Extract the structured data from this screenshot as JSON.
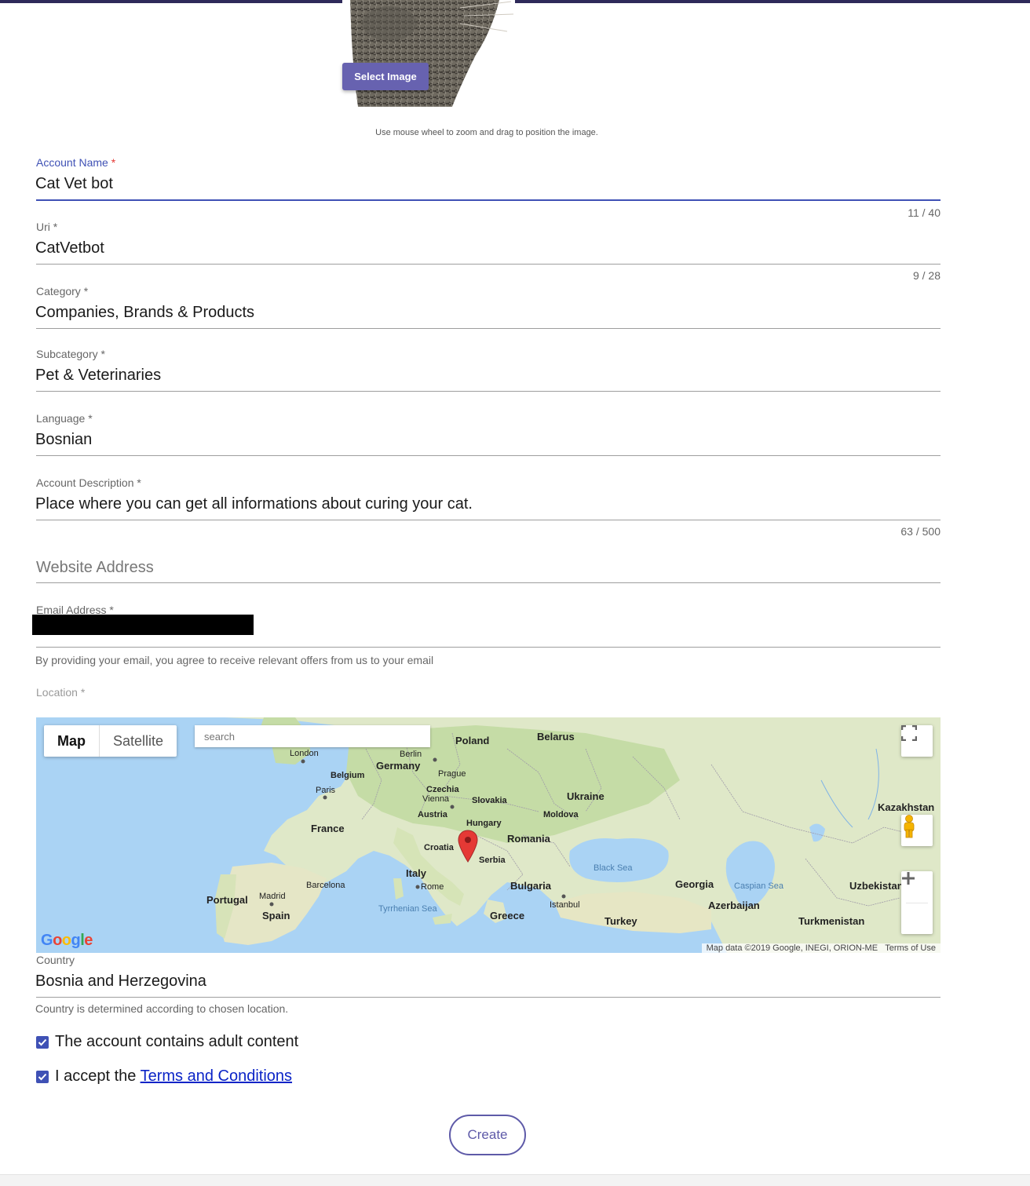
{
  "image_cropper": {
    "select_button": "Select Image",
    "hint": "Use mouse wheel to zoom and drag to position the image."
  },
  "fields": {
    "account_name": {
      "label": "Account Name",
      "required": "*",
      "value": "Cat Vet bot",
      "counter": "11 / 40"
    },
    "uri": {
      "label": "Uri",
      "required": "*",
      "value": "CatVetbot",
      "counter": "9 / 28"
    },
    "category": {
      "label": "Category",
      "required": "*",
      "value": "Companies, Brands & Products"
    },
    "subcategory": {
      "label": "Subcategory",
      "required": "*",
      "value": "Pet & Veterinaries"
    },
    "language": {
      "label": "Language",
      "required": "*",
      "value": "Bosnian"
    },
    "description": {
      "label": "Account Description",
      "required": "*",
      "value": "Place where you can get all informations about curing your cat.",
      "counter": "63 / 500"
    },
    "website": {
      "placeholder": "Website Address"
    },
    "email": {
      "label": "Email Address",
      "required": "*",
      "helper": "By providing your email, you agree to receive relevant offers from us to your email"
    },
    "location": {
      "label": "Location",
      "required": "*"
    },
    "country": {
      "label": "Country",
      "value": "Bosnia and Herzegovina",
      "helper": "Country is determined according to chosen location."
    }
  },
  "map": {
    "type_map": "Map",
    "type_satellite": "Satellite",
    "search_placeholder": "search",
    "attribution": "Map data ©2019 Google, INEGI, ORION-ME",
    "terms": "Terms of Use",
    "logo": "Google",
    "labels": {
      "poland": "Poland",
      "belarus": "Belarus",
      "london": "London",
      "berlin": "Berlin",
      "germany": "Germany",
      "belgium": "Belgium",
      "prague": "Prague",
      "czechia": "Czechia",
      "paris": "Paris",
      "vienna": "Vienna",
      "slovakia": "Slovakia",
      "ukraine": "Ukraine",
      "austria": "Austria",
      "moldova": "Moldova",
      "kazakhstan": "Kazakhstan",
      "france": "France",
      "hungary": "Hungary",
      "romania": "Romania",
      "croatia": "Croatia",
      "serbia": "Serbia",
      "black_sea": "Black Sea",
      "italy": "Italy",
      "barcelona": "Barcelona",
      "rome": "Rome",
      "bulgaria": "Bulgaria",
      "georgia": "Georgia",
      "caspian_sea": "Caspian Sea",
      "uzbekistan": "Uzbekistan",
      "portugal": "Portugal",
      "madrid": "Madrid",
      "tyrrhenian_sea": "Tyrrhenian Sea",
      "istanbul": "Istanbul",
      "azerbaijan": "Azerbaijan",
      "spain": "Spain",
      "greece": "Greece",
      "turkey": "Turkey",
      "turkmenistan": "Turkmenistan"
    },
    "icons": {
      "fullscreen": "fullscreen-icon",
      "pegman": "pegman-icon",
      "zoom_in": "plus-icon",
      "zoom_out": "minus-icon",
      "marker": "map-marker-icon"
    }
  },
  "checkboxes": {
    "adult": {
      "label": "The account contains adult content",
      "checked": true
    },
    "terms": {
      "prefix": "I accept the ",
      "link": "Terms and Conditions",
      "checked": true
    }
  },
  "create_button": "Create",
  "colors": {
    "accent": "#3f51b5",
    "brand": "#6762b0",
    "error": "#e53935",
    "link": "#0b24c7"
  }
}
